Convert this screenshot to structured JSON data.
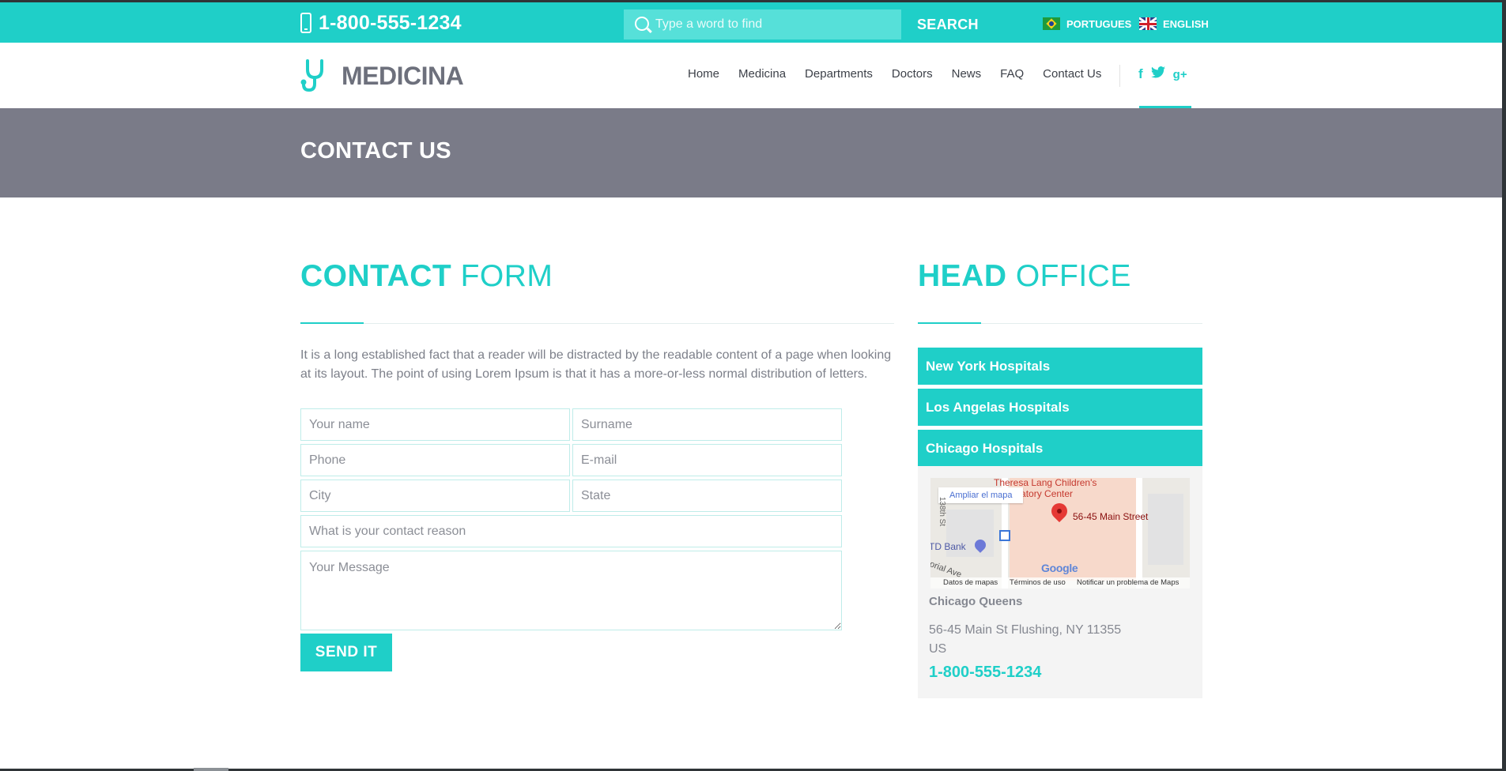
{
  "topbar": {
    "phone": "1-800-555-1234",
    "search_placeholder": "Type a word to find",
    "search_label": "SEARCH",
    "languages": [
      {
        "label": "PORTUGUES",
        "flag": "brazil-flag-icon"
      },
      {
        "label": "ENGLISH",
        "flag": "uk-flag-icon"
      }
    ]
  },
  "header": {
    "logo_text": "MEDICINA",
    "nav": [
      "Home",
      "Medicina",
      "Departments",
      "Doctors",
      "News",
      "FAQ",
      "Contact Us"
    ],
    "social": {
      "facebook": "f",
      "twitter": "twitter-icon",
      "googleplus": "g+"
    }
  },
  "page_title": "CONTACT US",
  "contact_form": {
    "title_bold": "CONTACT",
    "title_light": " FORM",
    "intro": "It is a long established fact that a reader will be distracted by the readable content of a page when looking at its layout. The point of using Lorem Ipsum is that it has a more-or-less normal distribution of letters.",
    "placeholders": {
      "name": "Your name",
      "surname": "Surname",
      "phone": "Phone",
      "email": "E-mail",
      "city": "City",
      "state": "State",
      "reason": "What is your contact reason",
      "message": "Your Message"
    },
    "submit_label": "SEND IT"
  },
  "head_office": {
    "title_bold": "HEAD",
    "title_light": " OFFICE",
    "accordion": [
      "New York Hospitals",
      "Los Angelas Hospitals",
      "Chicago Hospitals"
    ],
    "map": {
      "enlarge_label": "Ampliar el mapa",
      "pin_label": "56-45 Main Street",
      "top_label_line1": "Theresa Lang Children's",
      "top_label_line2": "Ambulatory Center",
      "bank_label": "TD Bank",
      "street_1": "138th St",
      "street_2": "orial Ave",
      "google": "Google",
      "attribution": [
        "Datos de mapas",
        "Términos de uso",
        "Notificar un problema de Maps"
      ]
    },
    "office_name": "Chicago Queens",
    "address_line1": "56-45 Main St Flushing, NY 11355",
    "address_line2": "US",
    "phone": "1-800-555-1234"
  },
  "colors": {
    "accent": "#1fcfc8",
    "title_band": "#7a7b88",
    "text": "#777b85"
  }
}
